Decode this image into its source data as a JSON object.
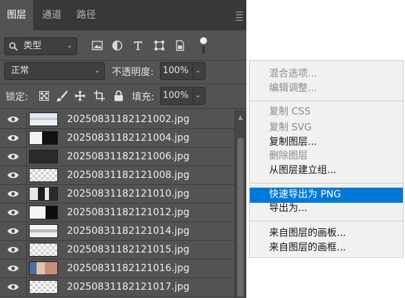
{
  "layers_panel": {
    "tabs": [
      {
        "label": "图层",
        "active": true
      },
      {
        "label": "通道",
        "active": false
      },
      {
        "label": "路径",
        "active": false
      }
    ],
    "filter": {
      "value": "类型"
    },
    "filter_icons": [
      "image-filter-icon",
      "adjustment-filter-icon",
      "type-filter-icon",
      "shape-filter-icon",
      "smart-object-filter-icon",
      "filter-toggle-icon"
    ],
    "blend_mode": "正常",
    "opacity_label": "不透明度:",
    "opacity_value": "100%",
    "lock_label": "锁定:",
    "lock_icons": [
      "lock-transparent-pixels-icon",
      "lock-image-pixels-icon",
      "lock-position-icon",
      "lock-artboard-icon",
      "lock-all-icon"
    ],
    "fill_label": "填充:",
    "fill_value": "100%",
    "layers": [
      {
        "name": "20250831182121002.jpg"
      },
      {
        "name": "20250831182121004.jpg"
      },
      {
        "name": "20250831182121006.jpg"
      },
      {
        "name": "20250831182121008.jpg"
      },
      {
        "name": "20250831182121010.jpg"
      },
      {
        "name": "20250831182121012.jpg"
      },
      {
        "name": "20250831182121014.jpg"
      },
      {
        "name": "20250831182121015.jpg"
      },
      {
        "name": "20250831182121016.jpg"
      },
      {
        "name": "20250831182121017.jpg"
      }
    ]
  },
  "context_menu": {
    "groups": [
      [
        {
          "label": "混合选项...",
          "enabled": false
        },
        {
          "label": "编辑调整...",
          "enabled": false
        }
      ],
      [
        {
          "label": "复制 CSS",
          "enabled": false
        },
        {
          "label": "复制 SVG",
          "enabled": false
        },
        {
          "label": "复制图层...",
          "enabled": true
        },
        {
          "label": "删除图层",
          "enabled": false
        },
        {
          "label": "从图层建立组...",
          "enabled": true
        }
      ],
      [
        {
          "label": "快速导出为 PNG",
          "enabled": true,
          "highlighted": true
        },
        {
          "label": "导出为...",
          "enabled": true
        }
      ],
      [
        {
          "label": "来自图层的画板...",
          "enabled": true
        },
        {
          "label": "来自图层的画框...",
          "enabled": true
        }
      ]
    ]
  },
  "colors": {
    "panel_bg": "#535353",
    "tab_bar_bg": "#383838",
    "menu_bg": "#f1f1f1",
    "menu_highlight": "#0078d7"
  }
}
